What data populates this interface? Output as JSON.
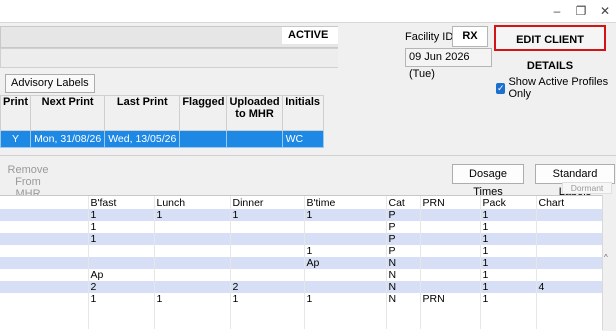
{
  "window": {
    "minimize_glyph": "–",
    "restore_glyph": "❐",
    "close_glyph": "✕"
  },
  "header": {
    "status": "ACTIVE",
    "facility_label": "Facility ID",
    "facility_id": "RX",
    "date": "09 Jun 2026 (Tue)",
    "edit_button": "EDIT CLIENT DETAILS"
  },
  "advisory_labels_button": "Advisory Labels",
  "show_active_profiles": {
    "label": "Show Active Profiles Only",
    "checked": true
  },
  "profile_table": {
    "headers": [
      "Print",
      "Next Print",
      "Last Print",
      "Flagged",
      "Uploaded to MHR",
      "Initials"
    ],
    "rows": [
      [
        "Y",
        "Mon, 31/08/26",
        "Wed, 13/05/26",
        "",
        "",
        "WC"
      ]
    ]
  },
  "toolbar": {
    "remove_from_mhr": "Remove From MHR",
    "dosage_times": "Dosage Times",
    "standard_labels": "Standard Labels",
    "dormant": "Dormant"
  },
  "dose_grid": {
    "headers": [
      "",
      "B'fast",
      "Lunch",
      "Dinner",
      "B'time",
      "Cat",
      "PRN",
      "Pack",
      "Chart"
    ],
    "rows": [
      [
        "",
        "1",
        "1",
        "1",
        "1",
        "P",
        "",
        "1",
        ""
      ],
      [
        "",
        "1",
        "",
        "",
        "",
        "P",
        "",
        "1",
        ""
      ],
      [
        "",
        "1",
        "",
        "",
        "",
        "P",
        "",
        "1",
        ""
      ],
      [
        "",
        "",
        "",
        "",
        "1",
        "P",
        "",
        "1",
        ""
      ],
      [
        "",
        "",
        "",
        "",
        "Ap",
        "N",
        "",
        "1",
        ""
      ],
      [
        "",
        "Ap",
        "",
        "",
        "",
        "N",
        "",
        "1",
        ""
      ],
      [
        "",
        "2",
        "",
        "2",
        "",
        "N",
        "",
        "1",
        "4"
      ],
      [
        "",
        "1",
        "1",
        "1",
        "1",
        "N",
        "PRN",
        "1",
        ""
      ],
      [
        "",
        "",
        "",
        "",
        "",
        "",
        "",
        "",
        ""
      ],
      [
        "",
        "",
        "",
        "",
        "",
        "",
        "",
        "",
        ""
      ]
    ]
  },
  "colors": {
    "selected_row": "#1e88e5",
    "alt_row": "#d6dff5",
    "highlight_border": "#d41414"
  }
}
